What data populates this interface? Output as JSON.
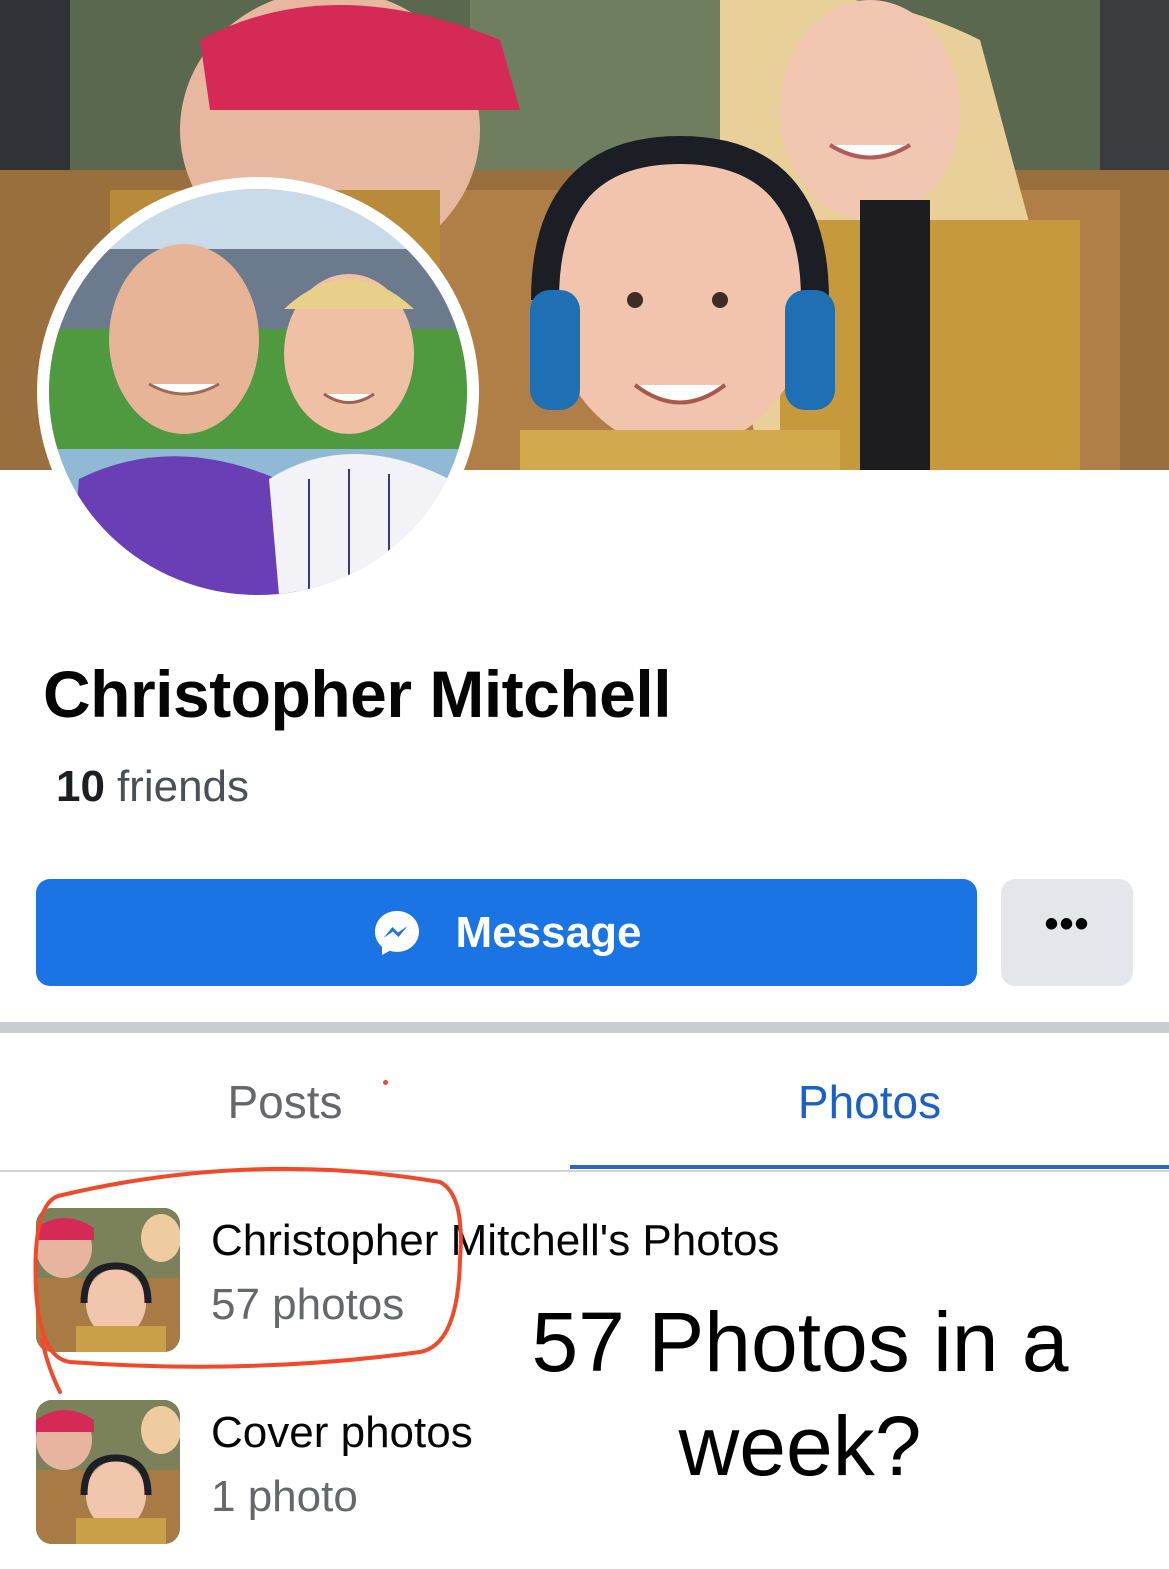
{
  "profile": {
    "name": "Christopher Mitchell",
    "friends_count": "10",
    "friends_label": "friends"
  },
  "actions": {
    "message_label": "Message",
    "message_icon": "messenger-icon",
    "more_label": "•••",
    "more_icon": "more-options-icon"
  },
  "tabs": [
    {
      "label": "Posts",
      "active": false
    },
    {
      "label": "Photos",
      "active": true
    }
  ],
  "albums": [
    {
      "title": "Christopher Mitchell's Photos",
      "count": "57 photos"
    },
    {
      "title": "Cover photos",
      "count": "1 photo"
    }
  ],
  "annotation": {
    "text_line1": "57 Photos in a",
    "text_line2": "week?",
    "color": "#000000",
    "highlight_color": "#f04a2a"
  },
  "colors": {
    "primary_button": "#1b74e4",
    "secondary_button": "#e4e6eb",
    "active_tab": "#1b60c8",
    "inactive_tab": "#65676b"
  }
}
